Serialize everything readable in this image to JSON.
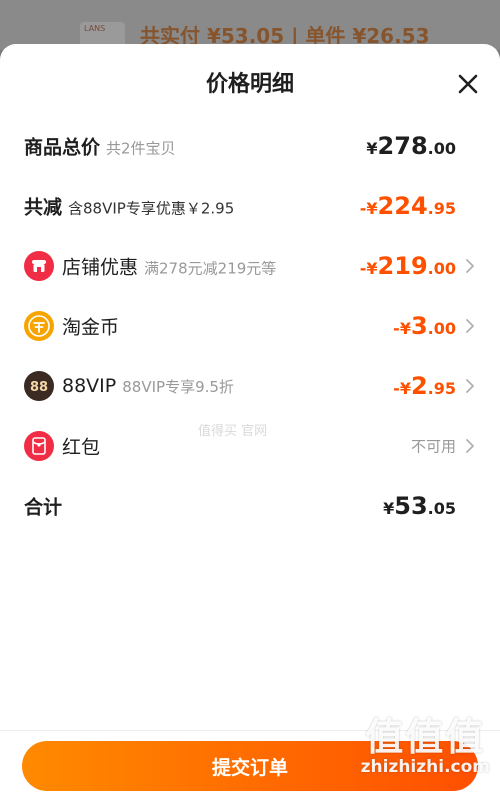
{
  "background": {
    "thumb_text": "LANS",
    "peek_text": "共实付 ¥53.05 | 单件 ¥26.53"
  },
  "sheet": {
    "title": "价格明细"
  },
  "rows": {
    "total": {
      "label": "商品总价",
      "sub": "共2件宝贝",
      "yen": "¥",
      "int": "278",
      "dec": ".00"
    },
    "reduce": {
      "label": "共减",
      "sub": "含88VIP专享优惠￥2.95",
      "yen": "-¥",
      "int": "224",
      "dec": ".95"
    },
    "store": {
      "label": "店铺优惠",
      "sub": "满278元减219元等",
      "yen": "-¥",
      "int": "219",
      "dec": ".00",
      "icon": "store-icon"
    },
    "coin": {
      "label": "淘金币",
      "yen": "-¥",
      "int": "3",
      "dec": ".00",
      "icon": "gold-coin-icon"
    },
    "vip": {
      "label": "88VIP",
      "sub": "88VIP专享9.5折",
      "yen": "-¥",
      "int": "2",
      "dec": ".95",
      "icon": "88vip-icon"
    },
    "redpack": {
      "label": "红包",
      "status": "不可用",
      "icon": "red-packet-icon"
    },
    "sum": {
      "label": "合计",
      "yen": "¥",
      "int": "53",
      "dec": ".05"
    }
  },
  "faint_overlay": "值得买  官网",
  "footer": {
    "submit_label": "提交订单"
  },
  "watermark": {
    "big": "值值值",
    "small": "zhizhizhi.com"
  },
  "colors": {
    "accent": "#ff5000",
    "button_start": "#ff8a00",
    "button_end": "#ff4f00",
    "store_icon": "#f02d44",
    "coin_icon": "#f7a400",
    "vip_icon": "#3a2a22",
    "redpack_icon": "#f02d44"
  }
}
